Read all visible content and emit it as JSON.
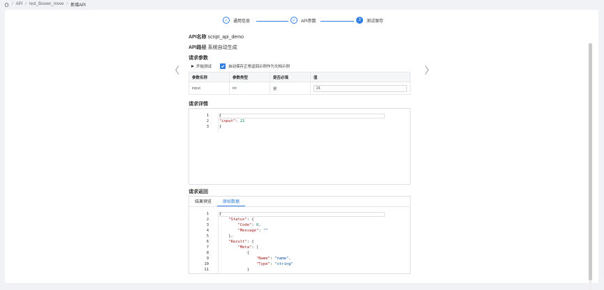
{
  "breadcrumb": {
    "items": [
      "API",
      "test_Bowen_move",
      "新增API"
    ]
  },
  "steps": [
    {
      "label": "通用信息",
      "state": "done"
    },
    {
      "label": "API参数",
      "state": "done"
    },
    {
      "label": "测试保存",
      "state": "active",
      "number": "3"
    }
  ],
  "info": {
    "name_key": "API名称",
    "name_value": "script_api_demo",
    "path_key": "API路径",
    "path_value": "系统自动生成"
  },
  "request_params": {
    "title": "请求参数",
    "start_test": "开始测试",
    "auto_save_label": "自动保存正常返回示例作为文档示例",
    "columns": [
      "参数名称",
      "参数类型",
      "是否必填",
      "值"
    ],
    "rows": [
      {
        "name": "input",
        "type": "int",
        "required": "是",
        "value": "21"
      }
    ]
  },
  "request_detail": {
    "title": "请求详情",
    "lines": [
      {
        "n": "1",
        "text": "{"
      },
      {
        "n": "2",
        "key": "\"input\"",
        "rest": ": ",
        "val": "21",
        "valtype": "num"
      },
      {
        "n": "3",
        "text": "}"
      }
    ]
  },
  "response": {
    "title": "请求返回",
    "tabs": [
      "结果预览",
      "原始数据"
    ],
    "active_tab": "原始数据",
    "lines": [
      {
        "n": "1",
        "text": "{"
      },
      {
        "n": "2",
        "indent": "    ",
        "key": "\"Status\"",
        "rest": ": {"
      },
      {
        "n": "3",
        "indent": "        ",
        "key": "\"Code\"",
        "rest": ": ",
        "val": "0",
        "valtype": "num",
        "tail": ","
      },
      {
        "n": "4",
        "indent": "        ",
        "key": "\"Message\"",
        "rest": ": ",
        "val": "\"\"",
        "valtype": "str"
      },
      {
        "n": "5",
        "indent": "    ",
        "text": "},"
      },
      {
        "n": "6",
        "indent": "    ",
        "key": "\"Result\"",
        "rest": ": {"
      },
      {
        "n": "7",
        "indent": "        ",
        "key": "\"Meta\"",
        "rest": ": ["
      },
      {
        "n": "8",
        "indent": "            ",
        "text": "{"
      },
      {
        "n": "9",
        "indent": "                ",
        "key": "\"Name\"",
        "rest": ": ",
        "val": "\"name\"",
        "valtype": "str",
        "tail": ","
      },
      {
        "n": "10",
        "indent": "                ",
        "key": "\"Type\"",
        "rest": ": ",
        "val": "\"string\"",
        "valtype": "str"
      },
      {
        "n": "11",
        "indent": "            ",
        "text": "}"
      }
    ]
  },
  "colors": {
    "accent": "#2f7de1"
  }
}
